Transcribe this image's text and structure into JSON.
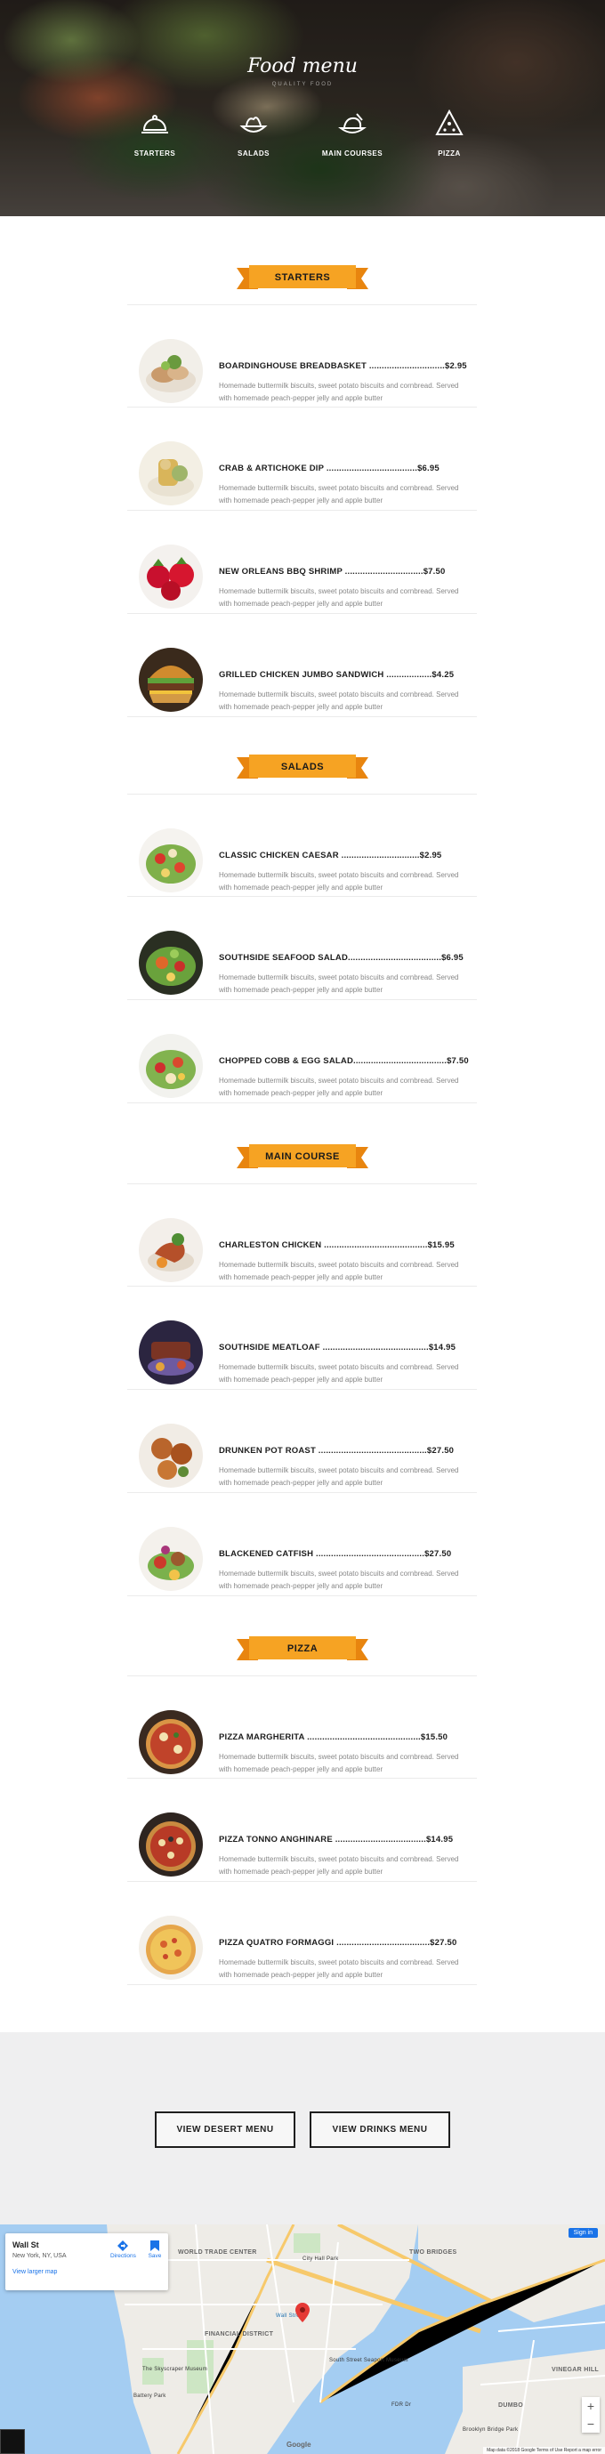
{
  "hero": {
    "title": "Food menu",
    "subtitle": "QUALITY FOOD",
    "nav": [
      {
        "label": "STARTERS",
        "icon": "cloche-icon"
      },
      {
        "label": "SALADS",
        "icon": "salad-icon"
      },
      {
        "label": "MAIN COURSES",
        "icon": "main-course-icon"
      },
      {
        "label": "PIZZA",
        "icon": "pizza-icon"
      }
    ]
  },
  "description": "Homemade buttermilk biscuits, sweet potato biscuits and cornbread. Served with homemade peach-pepper jelly and apple butter",
  "sections": [
    {
      "title": "STARTERS",
      "items": [
        {
          "name": "BOARDINGHOUSE BREADBASKET ..............................",
          "price": "$2.95",
          "food": "breadbasket"
        },
        {
          "name": "CRAB & ARTICHOKE DIP ....................................",
          "price": "$6.95",
          "food": "dip"
        },
        {
          "name": "NEW ORLEANS BBQ SHRIMP ...............................",
          "price": "$7.50",
          "food": "shrimp"
        },
        {
          "name": "GRILLED CHICKEN JUMBO SANDWICH ..................",
          "price": "$4.25",
          "food": "sandwich"
        }
      ]
    },
    {
      "title": "SALADS",
      "items": [
        {
          "name": "CLASSIC CHICKEN CAESAR ...............................",
          "price": "$2.95",
          "food": "salad"
        },
        {
          "name": "SOUTHSIDE SEAFOOD SALAD.....................................",
          "price": "$6.95",
          "food": "salad"
        },
        {
          "name": "CHOPPED COBB & EGG SALAD.....................................",
          "price": "$7.50",
          "food": "salad"
        }
      ]
    },
    {
      "title": "MAIN COURSE",
      "items": [
        {
          "name": "CHARLESTON CHICKEN .........................................",
          "price": "$15.95",
          "food": "chicken"
        },
        {
          "name": "SOUTHSIDE MEATLOAF ..........................................",
          "price": "$14.95",
          "food": "meatloaf"
        },
        {
          "name": "DRUNKEN POT ROAST ...........................................",
          "price": "$27.50",
          "food": "roast"
        },
        {
          "name": "BLACKENED CATFISH ...........................................",
          "price": "$27.50",
          "food": "catfish"
        }
      ]
    },
    {
      "title": "PIZZA",
      "items": [
        {
          "name": "PIZZA MARGHERITA .............................................",
          "price": "$15.50",
          "food": "pizza"
        },
        {
          "name": "PIZZA TONNO ANGHINARE ....................................",
          "price": "$14.95",
          "food": "pizza"
        },
        {
          "name": "PIZZA QUATRO FORMAGGI .....................................",
          "price": "$27.50",
          "food": "pizza"
        }
      ]
    }
  ],
  "buttons": {
    "desert": "VIEW DESERT MENU",
    "drinks": "VIEW DRINKS MENU"
  },
  "map": {
    "place": "Wall St",
    "address": "New York, NY, USA",
    "directions": "Directions",
    "save": "Save",
    "larger_map": "View larger map",
    "sign_in": "Sign in",
    "google": "Google",
    "attribution": "Map data ©2018 Google   Terms of Use   Report a map error",
    "labels": [
      "WORLD TRADE CENTER",
      "FINANCIAL DISTRICT",
      "TWO BRIDGES",
      "DUMBO",
      "VINEGAR HILL",
      "City Hall Park",
      "Wall Street",
      "Battery Park",
      "The Skyscraper Museum",
      "South Street Seaport Museum",
      "Brooklyn Bridge Park",
      "FDR Dr"
    ]
  }
}
